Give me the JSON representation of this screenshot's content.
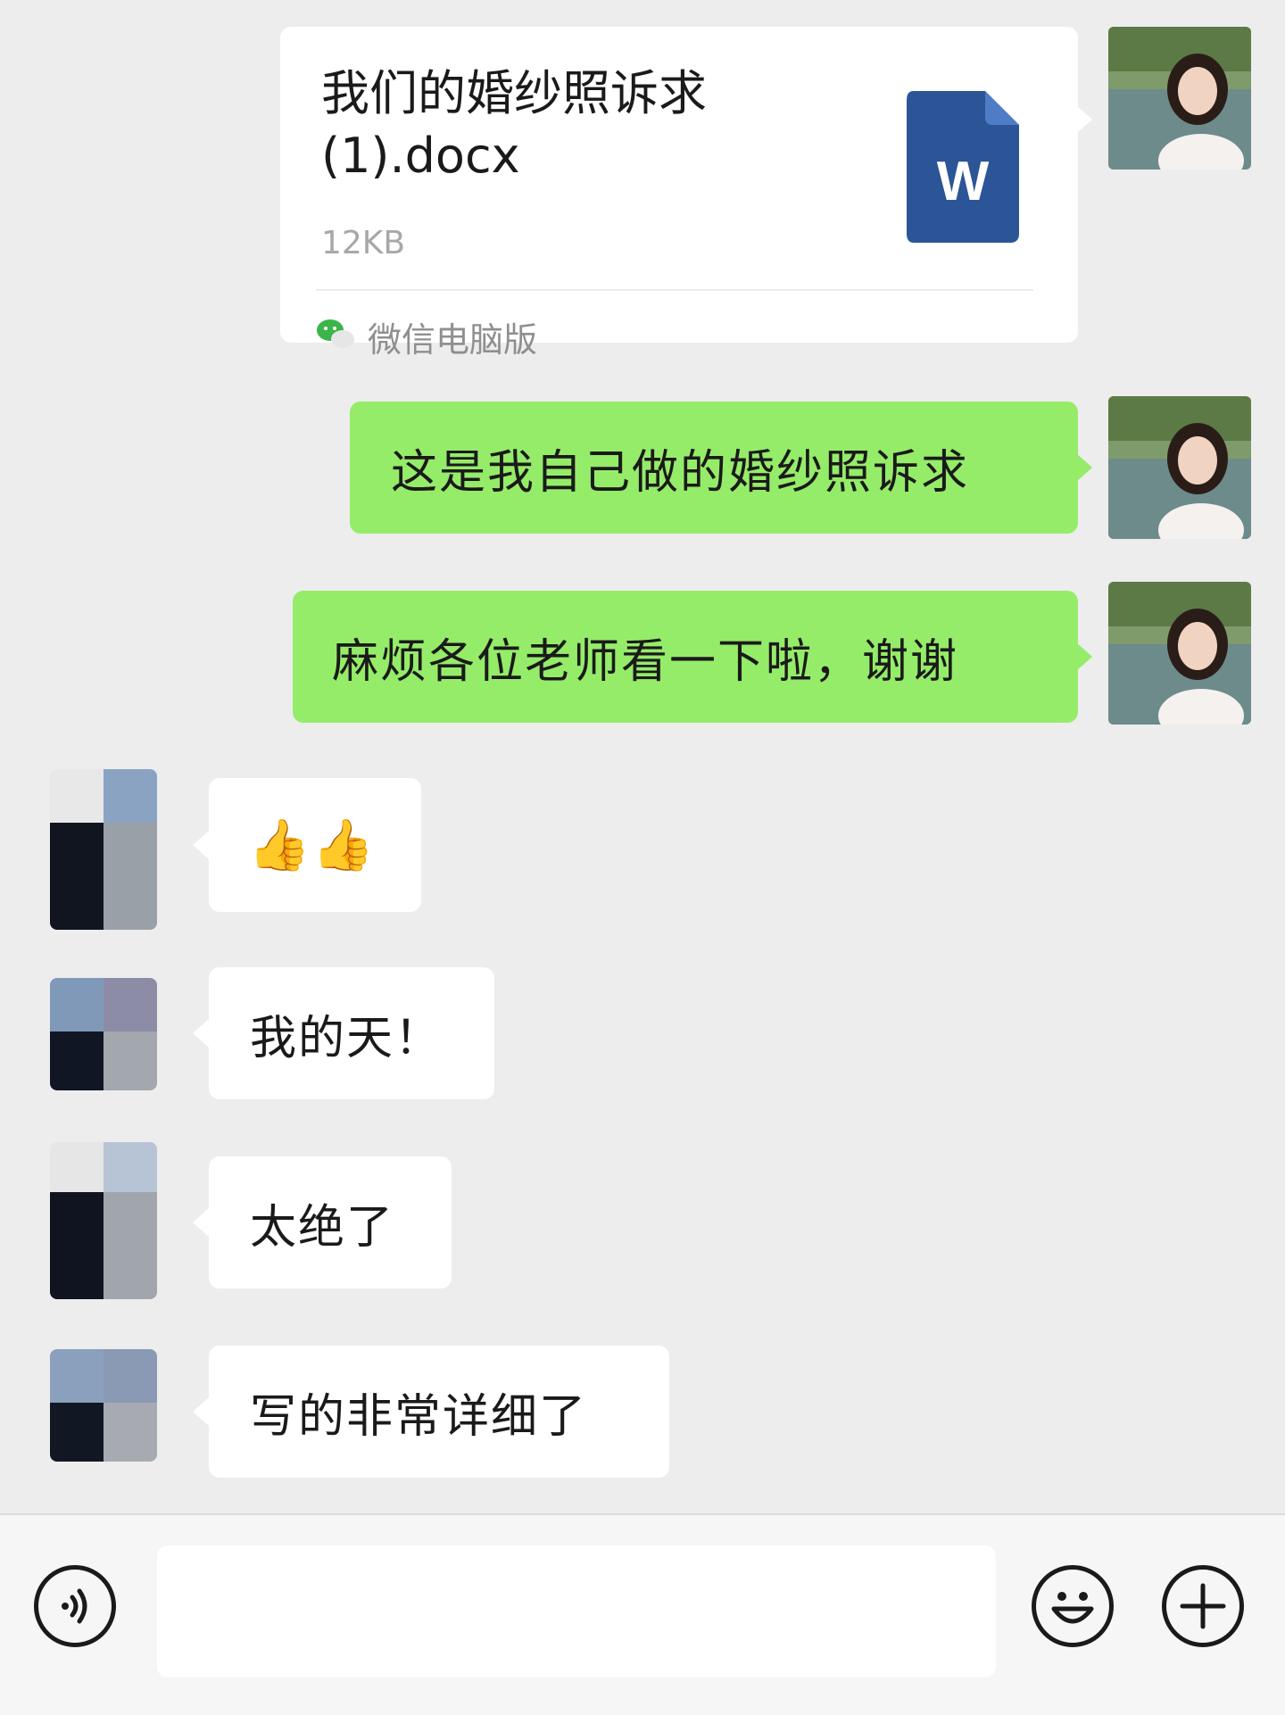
{
  "file_message": {
    "file_name": "我们的婚纱照诉求(1).docx",
    "file_size": "12KB",
    "source": "微信电脑版",
    "file_type_letter": "W"
  },
  "messages": [
    {
      "sender": "self",
      "text": "这是我自己做的婚纱照诉求"
    },
    {
      "sender": "self",
      "text": "麻烦各位老师看一下啦，谢谢"
    },
    {
      "sender": "other",
      "text": "👍👍"
    },
    {
      "sender": "other",
      "text": "我的天！"
    },
    {
      "sender": "other",
      "text": "太绝了"
    },
    {
      "sender": "other",
      "text": "写的非常详细了"
    }
  ],
  "input_bar": {
    "voice_icon": "voice-icon",
    "emoji_icon": "emoji-icon",
    "plus_icon": "plus-icon",
    "input_value": ""
  },
  "colors": {
    "background": "#ededed",
    "self_bubble": "#95ec69",
    "other_bubble": "#ffffff",
    "word_icon": "#2b5597"
  }
}
